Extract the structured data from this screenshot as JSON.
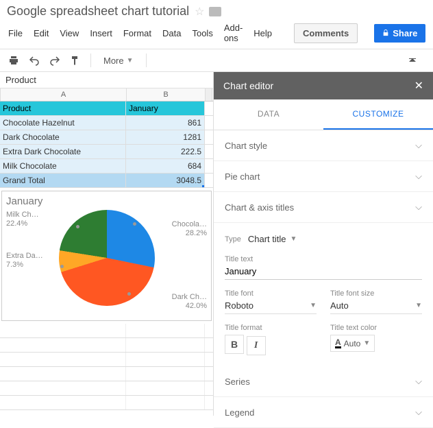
{
  "doc_title": "Google spreadsheet chart tutorial",
  "menus": [
    "File",
    "Edit",
    "View",
    "Insert",
    "Format",
    "Data",
    "Tools",
    "Add-ons",
    "Help"
  ],
  "comments_btn": "Comments",
  "share_btn": "Share",
  "more_btn": "More",
  "name_box": "Product",
  "columns": [
    "A",
    "B"
  ],
  "table": {
    "header": [
      "Product",
      "January"
    ],
    "rows": [
      [
        "Chocolate Hazelnut",
        "861"
      ],
      [
        "Dark Chocolate",
        "1281"
      ],
      [
        "Extra Dark Chocolate",
        "222.5"
      ],
      [
        "Milk Chocolate",
        "684"
      ]
    ],
    "total": [
      "Grand Total",
      "3048.5"
    ]
  },
  "chart": {
    "title": "January",
    "labels": {
      "milk": "Milk Ch…",
      "milk_pct": "22.4%",
      "extra": "Extra Da…",
      "extra_pct": "7.3%",
      "choc": "Chocola…",
      "choc_pct": "28.2%",
      "dark": "Dark Ch…",
      "dark_pct": "42.0%"
    }
  },
  "chart_data": {
    "type": "pie",
    "title": "January",
    "categories": [
      "Chocolate Hazelnut",
      "Dark Chocolate",
      "Extra Dark Chocolate",
      "Milk Chocolate"
    ],
    "values": [
      861,
      1281,
      222.5,
      684
    ],
    "percentages": [
      28.2,
      42.0,
      7.3,
      22.4
    ],
    "colors": [
      "#1e88e5",
      "#ff5722",
      "#ffa726",
      "#2e7d32"
    ]
  },
  "editor": {
    "title": "Chart editor",
    "tabs": {
      "data": "DATA",
      "customize": "CUSTOMIZE"
    },
    "sections": {
      "chart_style": "Chart style",
      "pie_chart": "Pie chart",
      "axis_titles": "Chart & axis titles",
      "series": "Series",
      "legend": "Legend"
    },
    "type_label": "Type",
    "type_value": "Chart title",
    "title_text_label": "Title text",
    "title_text_value": "January",
    "title_font_label": "Title font",
    "title_font_value": "Roboto",
    "title_size_label": "Title font size",
    "title_size_value": "Auto",
    "title_format_label": "Title format",
    "title_color_label": "Title text color",
    "title_color_value": "Auto"
  }
}
